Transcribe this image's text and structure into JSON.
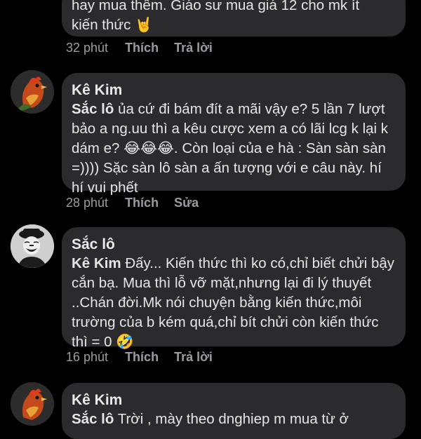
{
  "comments": [
    {
      "author": "",
      "text_line1": "hay mua thêm. Giáo sư mua giá 12 cho mk ít",
      "text_line2": "kiến thức 🤘",
      "time": "32 phút",
      "like_label": "Thích",
      "reply_label": "Trả lời"
    },
    {
      "author": "Kê Kim",
      "mention": "Sắc lô",
      "text": " ủa cứ đi bám đít a mãi vậy e? 5 lần 7 lượt bảo a ng.uu thì a kêu cược xem a có lãi lcg k lại k dám e? 😂😂😂. Còn loại của e hà : Sàn sàn sàn =)))) Sặc sàn lô sàn a ấn tượng với e câu này. hí hí vui phết",
      "time": "28 phút",
      "like_label": "Thích",
      "edit_label": "Sửa",
      "avatar_icon": "rooster-avatar-icon"
    },
    {
      "author": "Sắc lô",
      "mention": "Kê Kim",
      "text": " Đấy... Kiến thức thì ko có,chỉ biết chửi bậy cắn bạ. Mua thì lỗ vỡ mặt,nhưng lại đi lý thuyết ..Chán đời.Mk nói chuyện bằng kiến thức,môi trường của b kém quá,chỉ bít chửi còn kiến thức thì = 0 🤣",
      "time": "16 phút",
      "like_label": "Thích",
      "reply_label": "Trả lời",
      "avatar_icon": "laughing-man-avatar-icon"
    },
    {
      "author": "Kê Kim",
      "mention": "Sắc lô",
      "text": " Trời , mày theo dnghiep m mua từ ở",
      "avatar_icon": "rooster-avatar-icon"
    }
  ],
  "colors": {
    "background": "#000000",
    "bubble": "#2b2b2d",
    "meta_text": "#9a9ca1"
  }
}
